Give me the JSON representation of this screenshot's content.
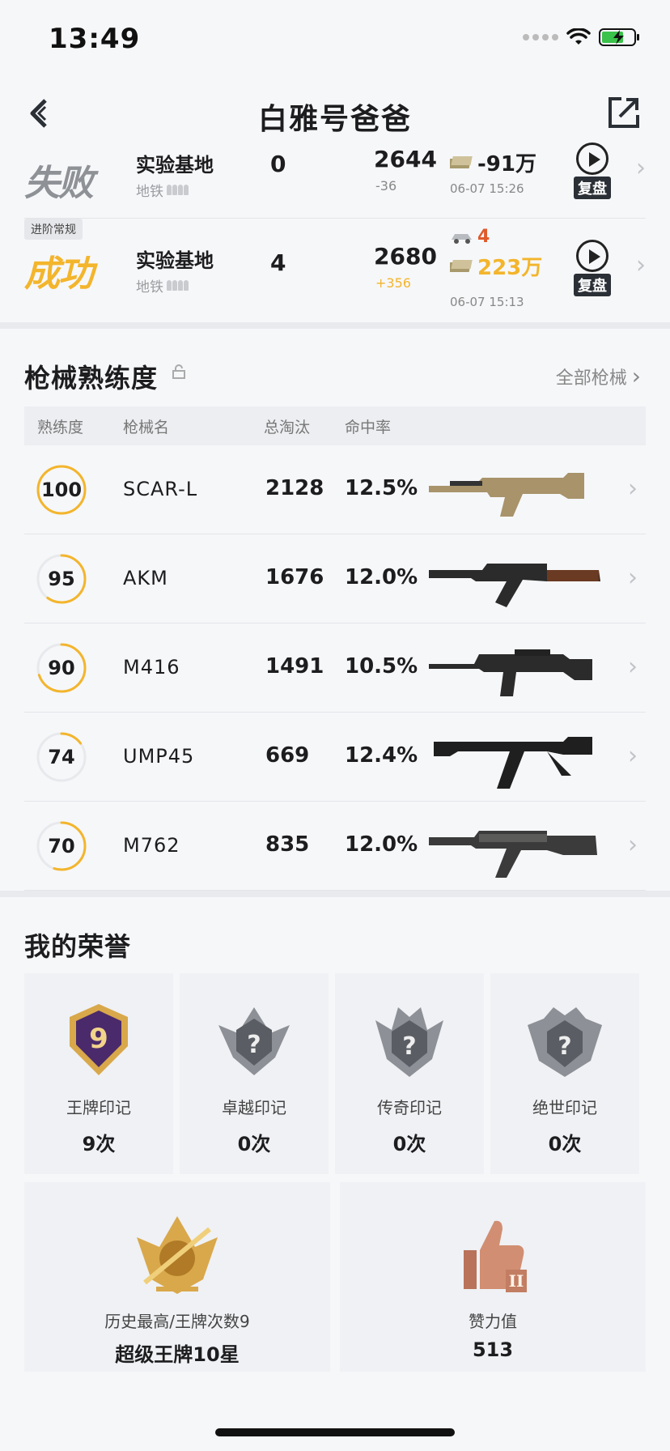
{
  "status_bar": {
    "time": "13:49"
  },
  "header": {
    "title": "白雅号爸爸"
  },
  "matches": [
    {
      "result": "失败",
      "tag": "",
      "map": "实验基地",
      "sub": "地铁",
      "kills": "0",
      "rating": "2644",
      "rating_delta": "-36",
      "vehicle_count": "",
      "money": "-91万",
      "time": "06-07 15:26",
      "replay_label": "复盘"
    },
    {
      "result": "成功",
      "tag": "进阶常规",
      "map": "实验基地",
      "sub": "地铁",
      "kills": "4",
      "rating": "2680",
      "rating_delta": "+356",
      "vehicle_count": "4",
      "money": "223万",
      "time": "06-07 15:13",
      "replay_label": "复盘"
    }
  ],
  "weapons_section": {
    "title": "枪械熟练度",
    "see_all": "全部枪械",
    "columns": [
      "熟练度",
      "枪械名",
      "总淘汰",
      "命中率"
    ],
    "rows": [
      {
        "level": 100,
        "level_label": "100",
        "name": "SCAR-L",
        "kills": "2128",
        "hit_rate": "12.5%",
        "progress": 1.0
      },
      {
        "level": 95,
        "level_label": "95",
        "name": "AKM",
        "kills": "1676",
        "hit_rate": "12.0%",
        "progress": 0.6
      },
      {
        "level": 90,
        "level_label": "90",
        "name": "M416",
        "kills": "1491",
        "hit_rate": "10.5%",
        "progress": 0.7
      },
      {
        "level": 74,
        "level_label": "74",
        "name": "UMP45",
        "kills": "669",
        "hit_rate": "12.4%",
        "progress": 0.15
      },
      {
        "level": 70,
        "level_label": "70",
        "name": "M762",
        "kills": "835",
        "hit_rate": "12.0%",
        "progress": 0.55
      }
    ]
  },
  "honors_section": {
    "title": "我的荣誉",
    "badges": [
      {
        "name": "王牌印记",
        "count": "9次",
        "badge_text": "9"
      },
      {
        "name": "卓越印记",
        "count": "0次",
        "badge_text": "?"
      },
      {
        "name": "传奇印记",
        "count": "0次",
        "badge_text": "?"
      },
      {
        "name": "绝世印记",
        "count": "0次",
        "badge_text": "?"
      }
    ],
    "best": {
      "label": "历史最高/王牌次数9",
      "value": "超级王牌10星"
    },
    "likes": {
      "label": "赞力值",
      "value": "513"
    }
  },
  "colors": {
    "accent_gold": "#f3b52c",
    "fail_gray": "#8e9195",
    "ring_track": "#e8e9ec"
  }
}
